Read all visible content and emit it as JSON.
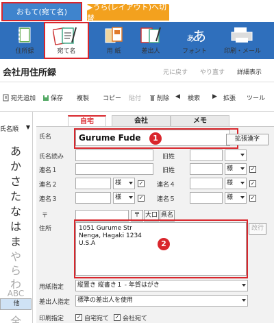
{
  "top_tabs": {
    "front": "おもて(宛て名)",
    "back": "▶うら(レイアウト)へ切替"
  },
  "ribbon": [
    {
      "label": "住所録",
      "icon": "address-book-icon"
    },
    {
      "label": "宛て名",
      "icon": "postcard-address-icon"
    },
    {
      "label": "用 紙",
      "icon": "paper-icon"
    },
    {
      "label": "差出人",
      "icon": "sender-icon"
    },
    {
      "label": "フォント",
      "icon": "font-icon"
    },
    {
      "label": "印刷・メール",
      "icon": "printer-icon"
    }
  ],
  "title": "会社用住所録",
  "title_actions": {
    "undo": "元に戻す",
    "redo": "やり直す",
    "detail": "詳細表示"
  },
  "toolbar": {
    "add": "宛先追加",
    "save": "保存",
    "copy_rec": "複製",
    "copy": "コピー",
    "paste": "貼付",
    "delete": "削除",
    "search": "検索",
    "expand": "拡張",
    "tools": "ツール"
  },
  "left": {
    "sort": "氏名順",
    "kana": [
      "あ",
      "か",
      "さ",
      "た",
      "な",
      "は",
      "ま",
      "や",
      "ら",
      "わ",
      "ABC",
      "他",
      "全"
    ]
  },
  "form_tabs": [
    "自宅",
    "会社",
    "メモ"
  ],
  "form": {
    "name_label": "氏名",
    "name_value": "Gurume Fude",
    "badge1": "1",
    "kanji_button": "拡張漢字",
    "reading_label": "氏名読み",
    "old_name_label": "旧姓",
    "renmei1": "連名１",
    "renmei2": "連名２",
    "renmei3": "連名３",
    "renmei4": "連名４",
    "renmei5": "連名５",
    "honorific": "様",
    "zip_label": "〒",
    "zip_button": "〒",
    "oguchi_button": "大口",
    "pref_button": "県名",
    "address_label": "住所",
    "address_lines": [
      "1051 Gurume Str",
      "Nenga, Hagaki 1234",
      "U.S.A"
    ],
    "newline_button": "改行",
    "badge2": "2",
    "paper_label": "用紙指定",
    "paper_value": "縦置き 縦書き１ - 年賀はがき",
    "sender_label": "差出人指定",
    "sender_value": "標準の差出人を使用",
    "print_label": "印刷指定",
    "print_home": "自宅宛て",
    "print_company": "会社宛て"
  },
  "colors": {
    "blue": "#2f6fbc",
    "orange": "#f3a11e",
    "red": "#d9262c"
  }
}
